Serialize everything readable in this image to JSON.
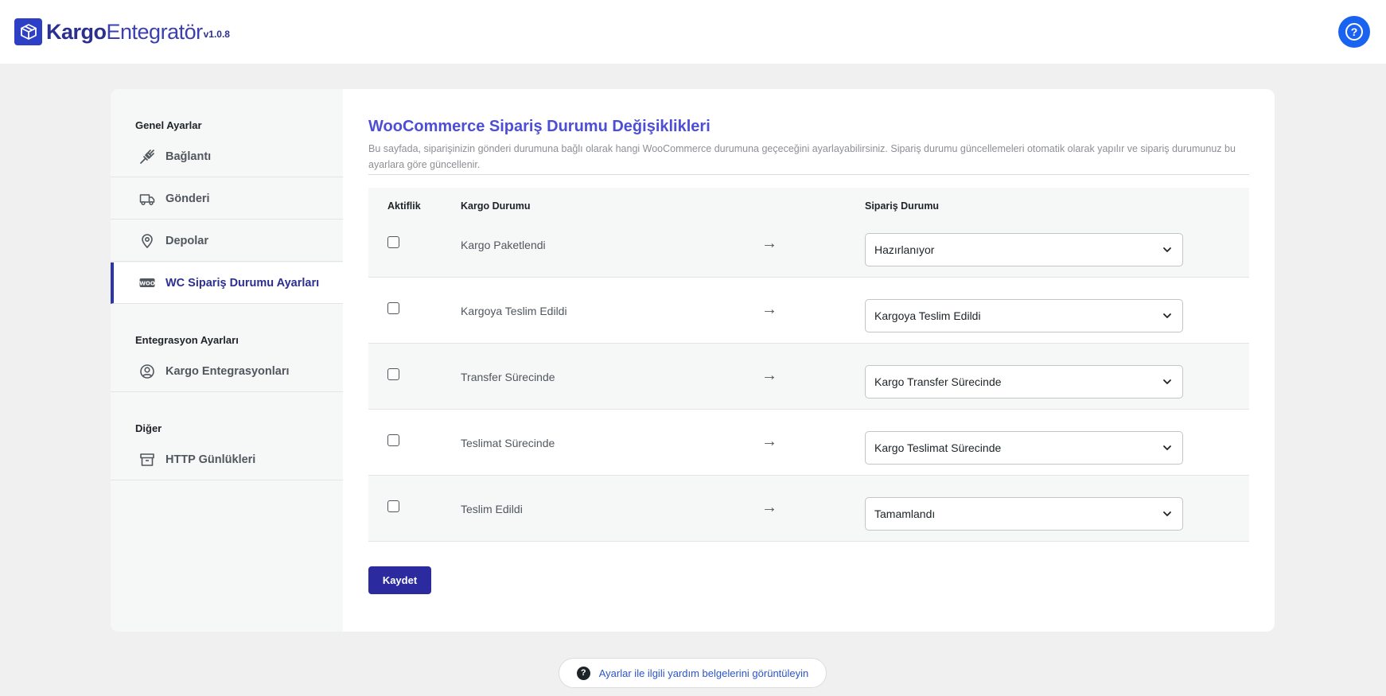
{
  "app": {
    "logo_strong": "Kargo",
    "logo_light": "Entegratör",
    "version": "v1.0.8",
    "help_icon_glyph": "?"
  },
  "sidebar": {
    "groups": [
      {
        "title": "Genel Ayarlar",
        "items": [
          {
            "label": "Bağlantı",
            "icon": "plug-icon"
          },
          {
            "label": "Gönderi",
            "icon": "truck-icon"
          },
          {
            "label": "Depolar",
            "icon": "location-pin-icon"
          },
          {
            "label": "WC Sipariş Durumu Ayarları",
            "icon": "woo-icon",
            "active": true
          }
        ]
      },
      {
        "title": "Entegrasyon Ayarları",
        "items": [
          {
            "label": "Kargo Entegrasyonları",
            "icon": "user-circle-icon"
          }
        ]
      },
      {
        "title": "Diğer",
        "items": [
          {
            "label": "HTTP Günlükleri",
            "icon": "archive-icon"
          }
        ]
      }
    ]
  },
  "main": {
    "title": "WooCommerce Sipariş Durumu Değişiklikleri",
    "description": "Bu sayfada, siparişinizin gönderi durumuna bağlı olarak hangi WooCommerce durumuna geçeceğini ayarlayabilirsiniz. Sipariş durumu güncellemeleri otomatik olarak yapılır ve sipariş durumunuz bu ayarlara göre güncellenir.",
    "columns": {
      "active": "Aktiflik",
      "cargo_status": "Kargo Durumu",
      "order_status": "Sipariş Durumu"
    },
    "arrow_glyph": "→",
    "rows": [
      {
        "checked": false,
        "cargo_status": "Kargo Paketlendi",
        "order_status": "Hazırlanıyor"
      },
      {
        "checked": false,
        "cargo_status": "Kargoya Teslim Edildi",
        "order_status": "Kargoya Teslim Edildi"
      },
      {
        "checked": false,
        "cargo_status": "Transfer Sürecinde",
        "order_status": "Kargo Transfer Sürecinde"
      },
      {
        "checked": false,
        "cargo_status": "Teslimat Sürecinde",
        "order_status": "Kargo Teslimat Sürecinde"
      },
      {
        "checked": false,
        "cargo_status": "Teslim Edildi",
        "order_status": "Tamamlandı"
      }
    ],
    "save_label": "Kaydet"
  },
  "footer": {
    "help_link": "Ayarlar ile ilgili yardım belgelerini görüntüleyin",
    "help_icon_glyph": "?"
  },
  "colors": {
    "accent": "#2b2a9e",
    "title": "#4c4fd6",
    "help_button": "#1a62f0",
    "link": "#2b55c9"
  }
}
